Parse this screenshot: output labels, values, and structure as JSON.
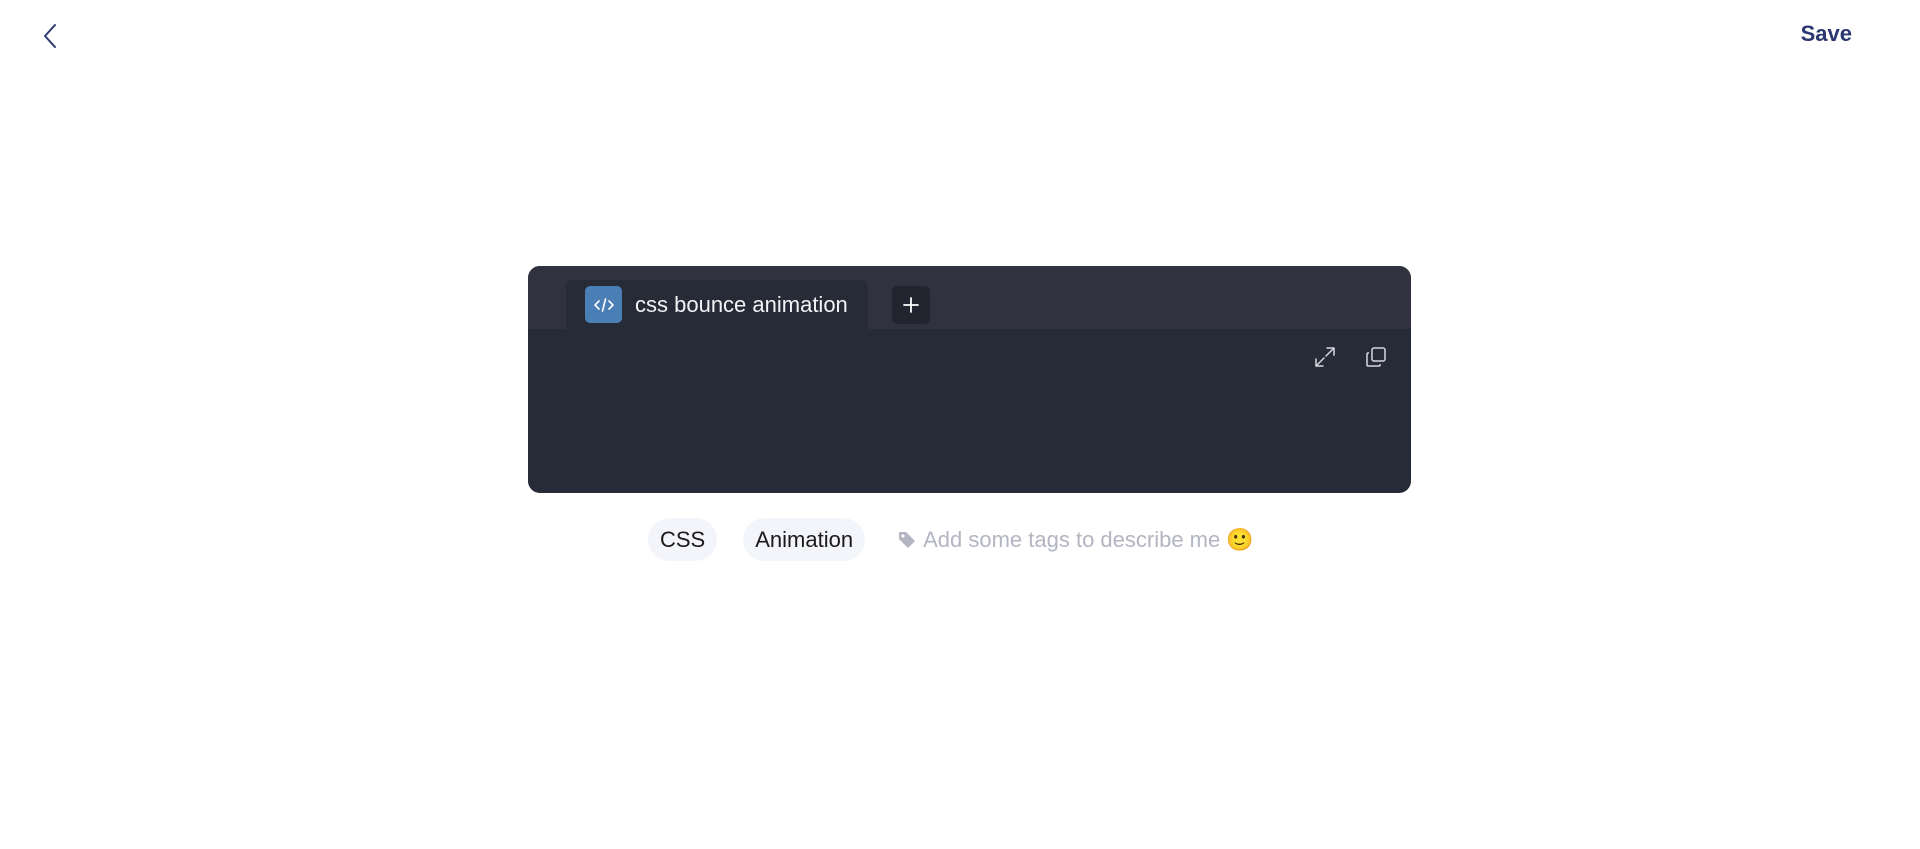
{
  "header": {
    "back_icon": "chevron-left-icon",
    "save_label": "Save"
  },
  "editor": {
    "tab": {
      "icon": "code-icon",
      "file_name": "css bounce animation"
    },
    "add_tab_icon": "plus-icon",
    "tools": {
      "expand_icon": "expand-icon",
      "copy_icon": "copy-icon"
    },
    "colors": {
      "panel": "#272a37",
      "tab_bar": "#30333f",
      "badge": "#4a7fb6"
    }
  },
  "tags": {
    "items": [
      "CSS",
      "Animation"
    ],
    "placeholder": "Add some tags to describe me 🙂",
    "tag_icon": "tag-icon"
  },
  "colors": {
    "accent": "#2b3770"
  }
}
